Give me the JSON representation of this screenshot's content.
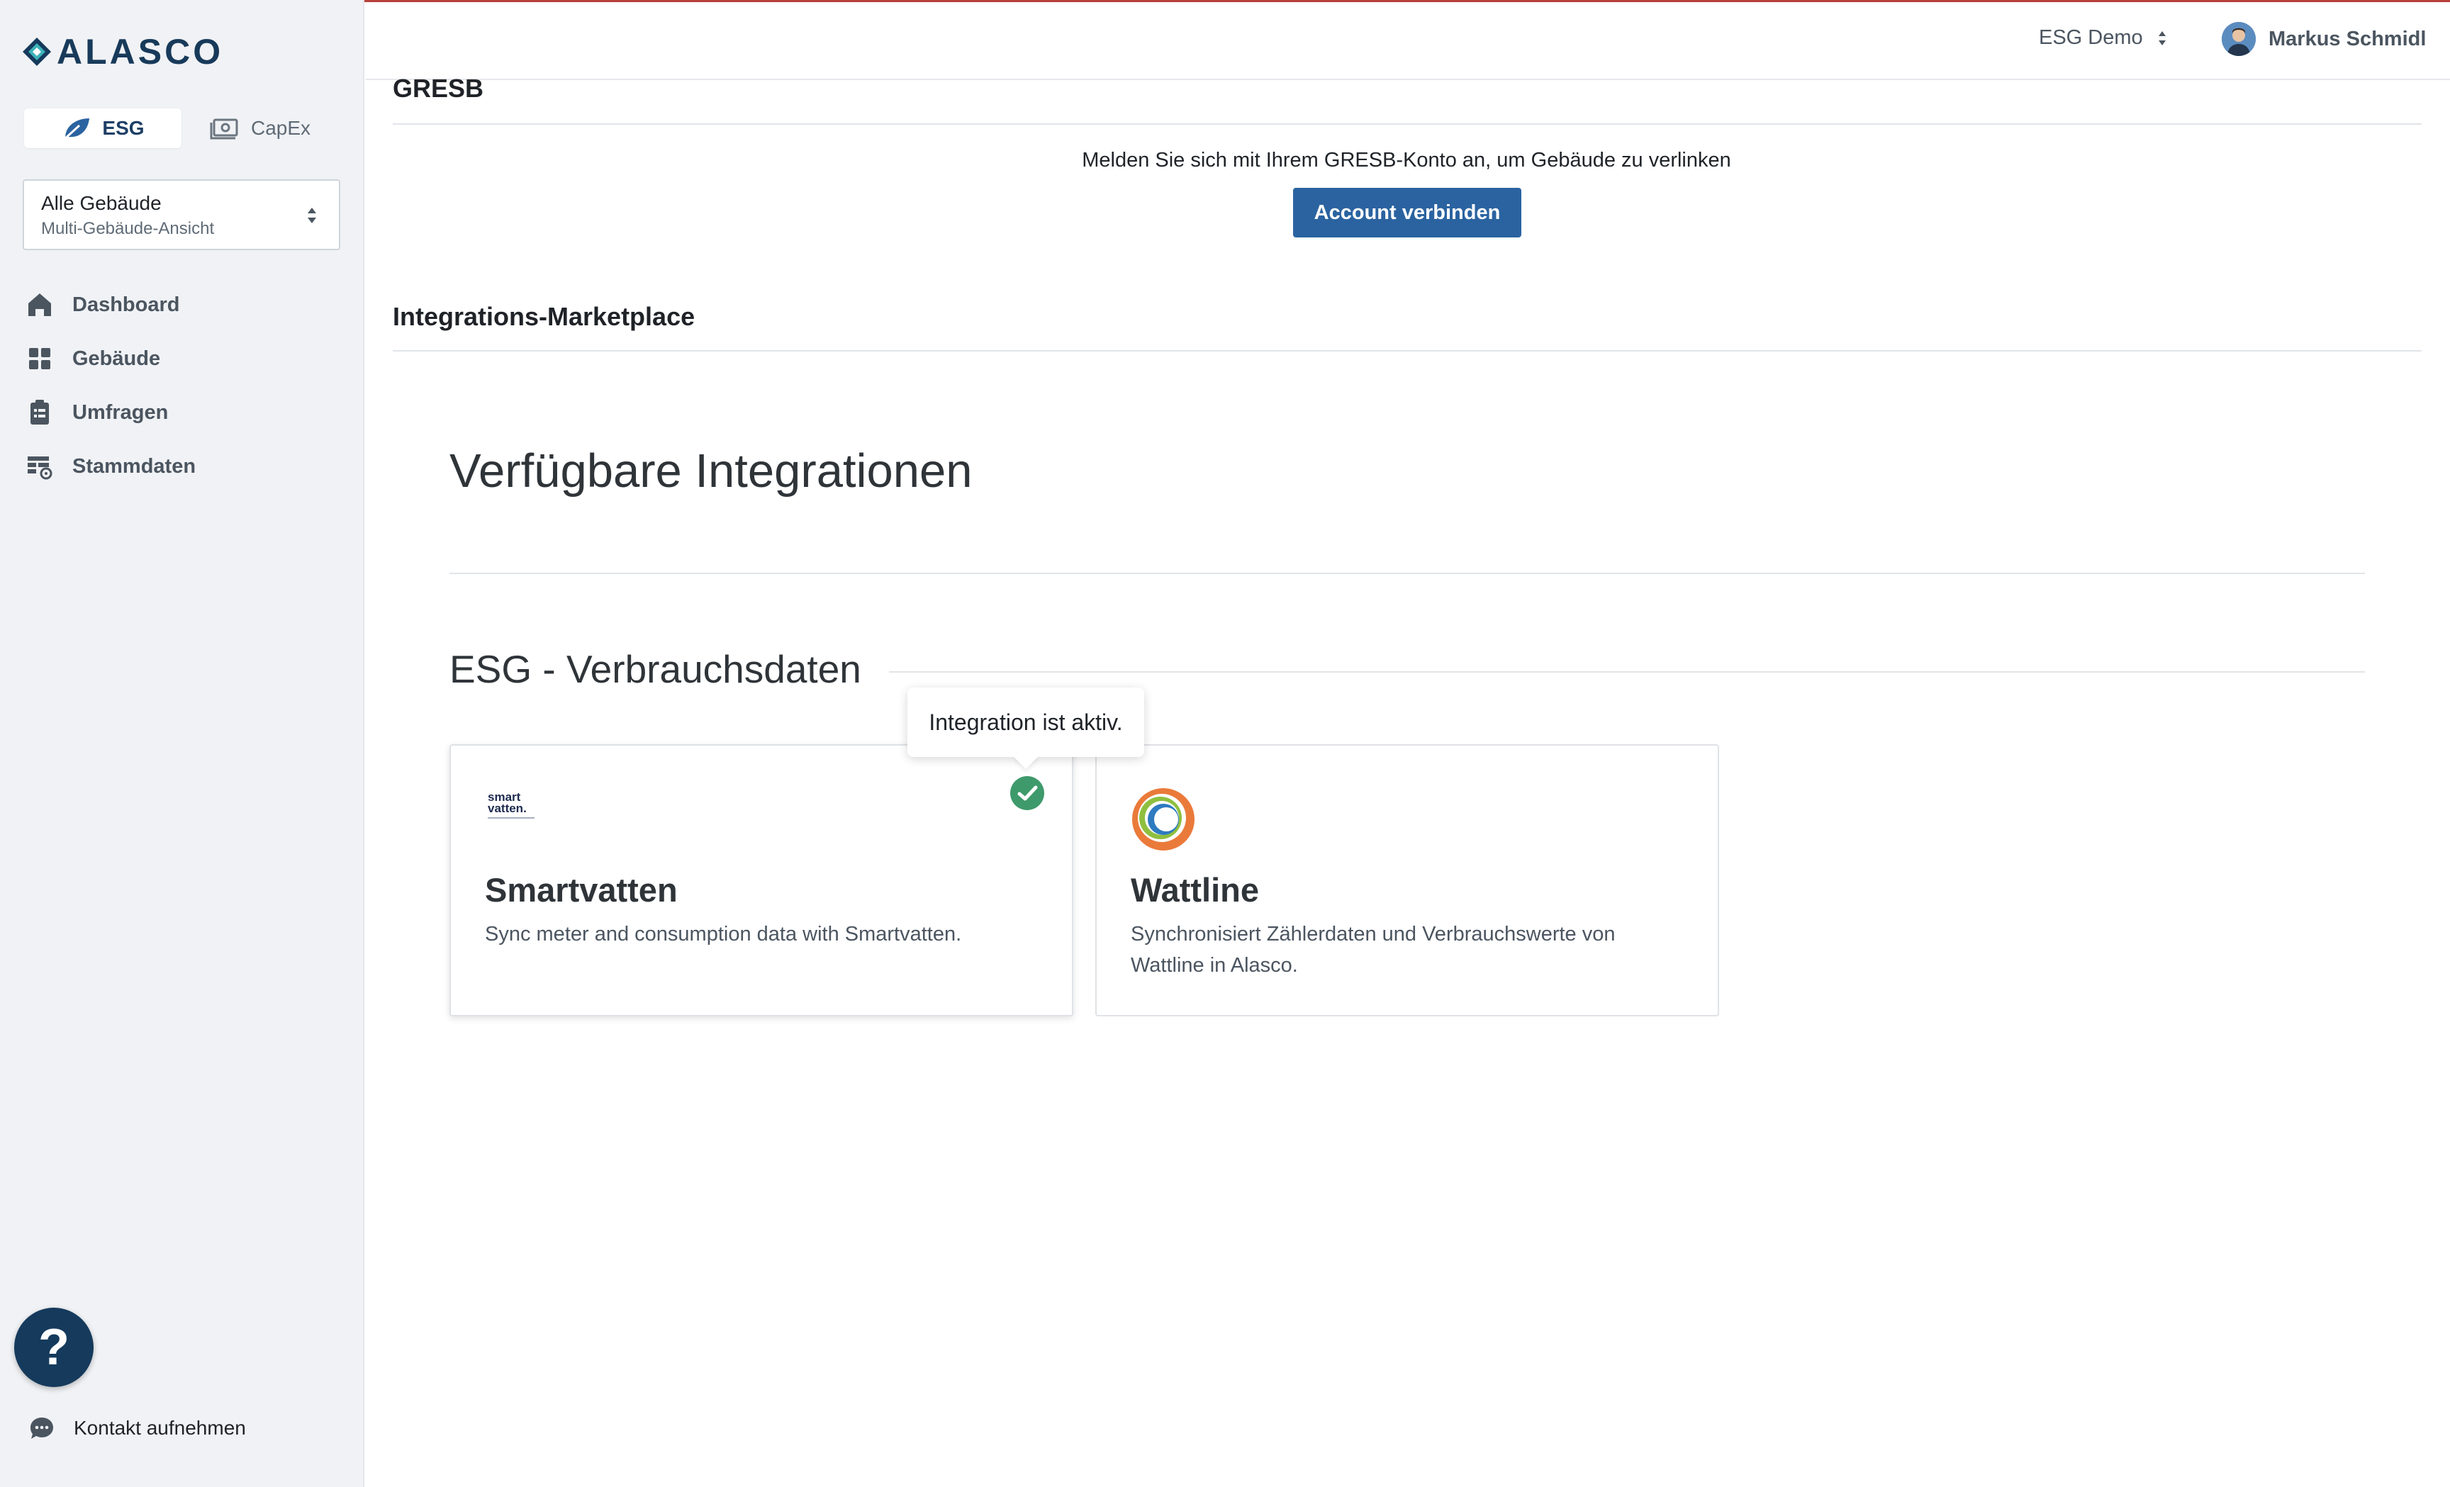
{
  "app": {
    "logo_text": "ALASCO",
    "colors": {
      "brand": "#153a5c",
      "primary_button": "#2a63a0",
      "sidebar_bg": "#f0f2f5",
      "success": "#3f9a6b"
    }
  },
  "sidebar": {
    "modules": [
      {
        "label": "ESG",
        "icon": "leaf-icon",
        "active": true
      },
      {
        "label": "CapEx",
        "icon": "money-icon",
        "active": false
      }
    ],
    "building_select": {
      "title": "Alle Gebäude",
      "subtitle": "Multi-Gebäude-Ansicht"
    },
    "nav": [
      {
        "label": "Dashboard",
        "icon": "home-icon"
      },
      {
        "label": "Gebäude",
        "icon": "grid-icon"
      },
      {
        "label": "Umfragen",
        "icon": "clipboard-icon"
      },
      {
        "label": "Stammdaten",
        "icon": "table-settings-icon"
      }
    ],
    "help_label": "?",
    "contact_label": "Kontakt aufnehmen"
  },
  "header": {
    "environment": "ESG Demo",
    "user_name": "Markus Schmidl"
  },
  "main": {
    "gresb": {
      "title": "GRESB",
      "message": "Melden Sie sich mit Ihrem GRESB-Konto an, um Gebäude zu verlinken",
      "button": "Account verbinden"
    },
    "marketplace": {
      "title": "Integrations-Marketplace",
      "available_title": "Verfügbare Integrationen",
      "category_title": "ESG - Verbrauchsdaten",
      "tooltip": "Integration ist aktiv.",
      "cards": [
        {
          "name": "Smartvatten",
          "description": "Sync meter and consumption data with Smartvatten.",
          "logo_text_line1": "smart",
          "logo_text_line2": "vatten.",
          "active": true
        },
        {
          "name": "Wattline",
          "description": "Synchronisiert Zählerdaten und Verbrauchswerte von Wattline in Alasco.",
          "active": false
        }
      ]
    }
  }
}
